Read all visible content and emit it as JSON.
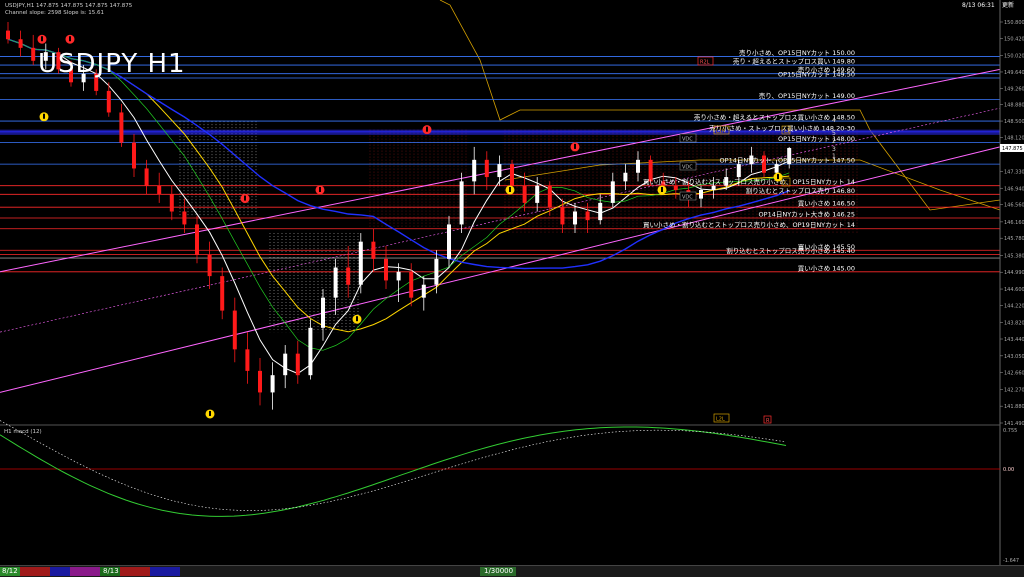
{
  "window": {
    "info_line1": "USDJPY,H1 147.875 147.875 147.875 147.875",
    "info_line2": "Channel slope: 2598 Slope is: 15.61",
    "datetime": "8/13 06:31 ",
    "datetime_suffix": "更新",
    "big_title": "USDJPY H1"
  },
  "price_scale": {
    "labels": [
      {
        "p": 150.8,
        "t": "150.800"
      },
      {
        "p": 150.42,
        "t": "150.420"
      },
      {
        "p": 150.02,
        "t": "150.020"
      },
      {
        "p": 149.64,
        "t": "149.640"
      },
      {
        "p": 149.26,
        "t": "149.260"
      },
      {
        "p": 148.88,
        "t": "148.880"
      },
      {
        "p": 148.5,
        "t": "148.500"
      },
      {
        "p": 148.12,
        "t": "148.120"
      },
      {
        "p": 147.875,
        "t": "147.875"
      },
      {
        "p": 147.33,
        "t": "147.330"
      },
      {
        "p": 146.94,
        "t": "146.940"
      },
      {
        "p": 146.56,
        "t": "146.560"
      },
      {
        "p": 146.16,
        "t": "146.160"
      },
      {
        "p": 145.78,
        "t": "145.780"
      },
      {
        "p": 145.38,
        "t": "145.380"
      },
      {
        "p": 144.99,
        "t": "144.990"
      },
      {
        "p": 144.6,
        "t": "144.600"
      },
      {
        "p": 144.22,
        "t": "144.220"
      },
      {
        "p": 143.82,
        "t": "143.820"
      },
      {
        "p": 143.44,
        "t": "143.440"
      },
      {
        "p": 143.05,
        "t": "143.050"
      },
      {
        "p": 142.66,
        "t": "142.660"
      },
      {
        "p": 142.27,
        "t": "142.270"
      },
      {
        "p": 141.88,
        "t": "141.880"
      },
      {
        "p": 141.49,
        "t": "141.490"
      }
    ],
    "current_price": "147.875"
  },
  "levels": [
    {
      "label": "売り小さめ、OP15日NYカット 150.00",
      "p": 150.0,
      "color": "#3a78ff"
    },
    {
      "label": "売り・超えるとストップロス買い 149.80",
      "p": 149.8,
      "color": "#3a78ff"
    },
    {
      "label": "売り小さめ 149.60",
      "p": 149.6,
      "color": "#3a78ff"
    },
    {
      "label": "OP15日NYカット 149.50",
      "p": 149.5,
      "color": "#3a78ff"
    },
    {
      "label": "売り、OP15日NYカット 149.00",
      "p": 149.0,
      "color": "#3a78ff"
    },
    {
      "label": "売り小さめ・超えるとストップロス買い小さめ 148.50",
      "p": 148.5,
      "color": "#3a78ff"
    },
    {
      "label": "売り小さめ・ストップロス買い小さめ 148.20-30",
      "p": 148.25,
      "color": "#2a2aff"
    },
    {
      "label": "OP15日NYカット 148.00",
      "p": 148.0,
      "color": "#3a78ff"
    },
    {
      "label": "OP14日NYカット、OP15日NYカット 147.50",
      "p": 147.5,
      "color": "#3a78ff"
    },
    {
      "label": "買い小さめ・割り込むとストップロス売り小さめ、OP15日NYカット 14",
      "p": 147.0,
      "color": "#ff2a2a"
    },
    {
      "label": "割り込むとストップロス売り 146.80",
      "p": 146.8,
      "color": "#ff2a2a"
    },
    {
      "label": "買い小さめ 146.50",
      "p": 146.5,
      "color": "#ff2a2a"
    },
    {
      "label": "OP14日NYカット大きめ 146.25",
      "p": 146.25,
      "color": "#ff2a2a"
    },
    {
      "label": "買い小さめ・割り込むとストップロス売り小さめ、OP19日NYカット 14",
      "p": 146.0,
      "color": "#ff2a2a"
    },
    {
      "label": "買い小さめ 145.50",
      "p": 145.5,
      "color": "#ff2a2a"
    },
    {
      "label": "割り込むとストップロス売り小さめ 145.40",
      "p": 145.4,
      "color": "#ff2a2a"
    },
    {
      "label": "買い小さめ 145.00",
      "p": 145.0,
      "color": "#ff2a2a"
    }
  ],
  "tags": {
    "r2l": "R2L",
    "l2l": "L2L",
    "vdc": "VDC",
    "l1r": "L1R",
    "l1": "L1",
    "c": "C",
    "r": "R",
    "l4": "L4",
    "num5": "5",
    "num4": "4",
    "num2": "2",
    "num3": "3",
    "num1": "1",
    "c1": "C",
    "v0": "0"
  },
  "macd": {
    "label": "H1 macd (12)",
    "top_value": "0.755",
    "zero_value": "0.00",
    "bottom_value": "-1.647",
    "zero_line_color": "#cc0000"
  },
  "statusbar": {
    "left_label": "8/12",
    "mid_label": "8/13",
    "right_label": "1/30000"
  },
  "colors": {
    "bull_candle": "#ffffff",
    "bear_candle": "#ff1a1a",
    "ma_white": "#ffffff",
    "ma_yellow": "#ffd700",
    "ma_blue": "#2030ff",
    "ichimoku_green": "#22cc22",
    "kumo_red": "#cc2222",
    "kumo_orange": "#d4a000",
    "channel_pink": "#ff66ff",
    "macd_green": "#33cc33",
    "macd_pink": "#ff77aa"
  },
  "chart_data": {
    "type": "candlestick",
    "symbol": "USDJPY",
    "timeframe": "H1",
    "ylim": [
      141.49,
      150.8
    ],
    "series": [
      {
        "name": "candles",
        "values": [
          [
            150.6,
            150.8,
            150.3,
            150.4
          ],
          [
            150.4,
            150.6,
            150.0,
            150.2
          ],
          [
            150.2,
            150.5,
            149.8,
            149.9
          ],
          [
            149.9,
            150.3,
            149.7,
            150.1
          ],
          [
            150.1,
            150.2,
            149.6,
            149.7
          ],
          [
            149.7,
            149.9,
            149.3,
            149.4
          ],
          [
            149.4,
            149.8,
            149.2,
            149.6
          ],
          [
            149.6,
            149.7,
            149.1,
            149.2
          ],
          [
            149.2,
            149.4,
            148.6,
            148.7
          ],
          [
            148.7,
            148.9,
            147.9,
            148.0
          ],
          [
            148.0,
            148.2,
            147.2,
            147.4
          ],
          [
            147.4,
            147.6,
            146.8,
            147.0
          ],
          [
            147.0,
            147.3,
            146.6,
            146.8
          ],
          [
            146.8,
            147.0,
            146.2,
            146.4
          ],
          [
            146.4,
            146.7,
            145.9,
            146.1
          ],
          [
            146.1,
            146.3,
            145.2,
            145.4
          ],
          [
            145.4,
            145.7,
            144.6,
            144.9
          ],
          [
            144.9,
            145.1,
            143.9,
            144.1
          ],
          [
            144.1,
            144.4,
            142.9,
            143.2
          ],
          [
            143.2,
            143.6,
            142.4,
            142.7
          ],
          [
            142.7,
            143.0,
            141.9,
            142.2
          ],
          [
            142.2,
            142.9,
            141.8,
            142.6
          ],
          [
            142.6,
            143.3,
            142.3,
            143.1
          ],
          [
            143.1,
            143.4,
            142.4,
            142.6
          ],
          [
            142.6,
            143.9,
            142.5,
            143.7
          ],
          [
            143.7,
            144.6,
            143.4,
            144.4
          ],
          [
            144.4,
            145.3,
            144.0,
            145.1
          ],
          [
            145.1,
            145.6,
            144.4,
            144.7
          ],
          [
            144.7,
            145.9,
            144.5,
            145.7
          ],
          [
            145.7,
            146.0,
            145.0,
            145.3
          ],
          [
            145.3,
            145.6,
            144.6,
            144.8
          ],
          [
            144.8,
            145.2,
            144.3,
            145.0
          ],
          [
            145.0,
            145.2,
            144.2,
            144.4
          ],
          [
            144.4,
            144.9,
            144.1,
            144.7
          ],
          [
            144.7,
            145.5,
            144.5,
            145.3
          ],
          [
            145.3,
            146.3,
            145.1,
            146.1
          ],
          [
            146.1,
            147.3,
            145.9,
            147.1
          ],
          [
            147.1,
            147.9,
            146.8,
            147.6
          ],
          [
            147.6,
            147.8,
            146.9,
            147.2
          ],
          [
            147.2,
            147.7,
            147.0,
            147.5
          ],
          [
            147.5,
            147.6,
            146.8,
            147.0
          ],
          [
            147.0,
            147.3,
            146.4,
            146.6
          ],
          [
            146.6,
            147.2,
            146.4,
            147.0
          ],
          [
            147.0,
            147.1,
            146.3,
            146.5
          ],
          [
            146.5,
            146.7,
            145.9,
            146.1
          ],
          [
            146.1,
            146.6,
            145.9,
            146.4
          ],
          [
            146.4,
            146.6,
            145.9,
            146.2
          ],
          [
            146.2,
            146.8,
            146.1,
            146.6
          ],
          [
            146.6,
            147.3,
            146.5,
            147.1
          ],
          [
            147.1,
            147.5,
            146.9,
            147.3
          ],
          [
            147.3,
            147.8,
            147.1,
            147.6
          ],
          [
            147.6,
            147.7,
            147.0,
            147.1
          ],
          [
            147.1,
            147.3,
            146.8,
            147.0
          ],
          [
            147.0,
            147.2,
            146.7,
            146.9
          ],
          [
            146.9,
            147.1,
            146.5,
            146.7
          ],
          [
            146.7,
            147.0,
            146.5,
            146.9
          ],
          [
            146.9,
            147.2,
            146.7,
            147.0
          ],
          [
            147.0,
            147.4,
            146.9,
            147.2
          ],
          [
            147.2,
            147.6,
            147.0,
            147.5
          ],
          [
            147.5,
            147.9,
            147.3,
            147.7
          ],
          [
            147.7,
            147.8,
            147.2,
            147.3
          ],
          [
            147.3,
            147.6,
            147.1,
            147.5
          ],
          [
            147.5,
            147.9,
            147.4,
            147.875
          ]
        ]
      }
    ]
  }
}
